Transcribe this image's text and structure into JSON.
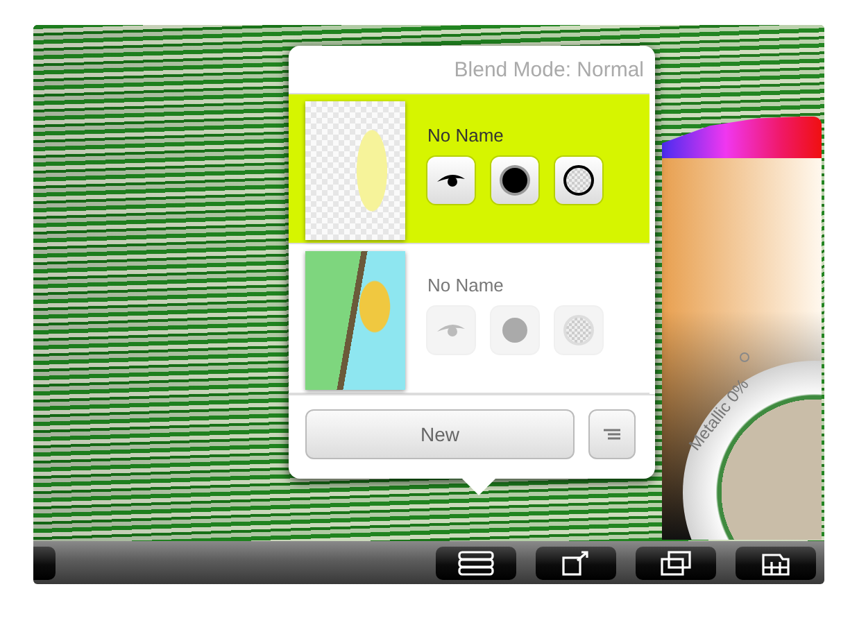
{
  "popover": {
    "blend_mode": "Blend Mode: Normal",
    "layers": [
      {
        "name": "No Name",
        "selected": true
      },
      {
        "name": "No Name",
        "selected": false
      }
    ],
    "new_button": "New"
  },
  "color_picker": {
    "metallic_label": "Metallic 0%"
  }
}
